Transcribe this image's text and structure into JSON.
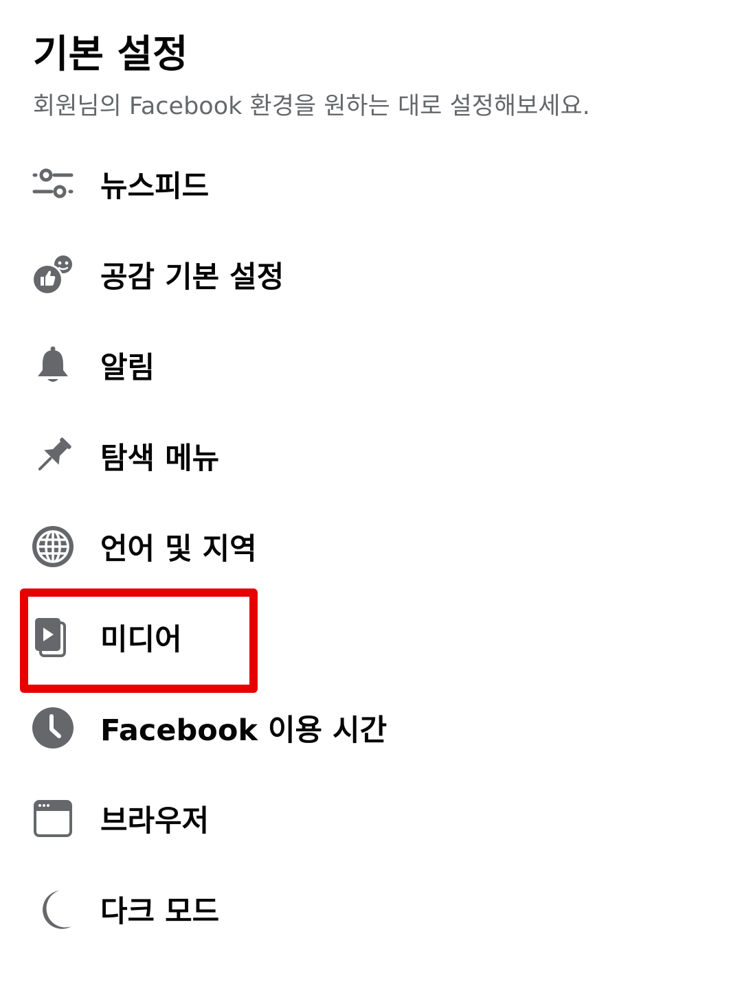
{
  "header": {
    "title": "기본 설정",
    "subtitle": "회원님의 Facebook 환경을 원하는 대로 설정해보세요."
  },
  "menu": {
    "items": [
      {
        "label": "뉴스피드",
        "icon": "sliders-icon"
      },
      {
        "label": "공감 기본 설정",
        "icon": "reactions-icon"
      },
      {
        "label": "알림",
        "icon": "bell-icon"
      },
      {
        "label": "탐색 메뉴",
        "icon": "pin-icon"
      },
      {
        "label": "언어 및 지역",
        "icon": "globe-icon"
      },
      {
        "label": "미디어",
        "icon": "media-icon"
      },
      {
        "label": "Facebook 이용 시간",
        "icon": "clock-icon"
      },
      {
        "label": "브라우저",
        "icon": "browser-icon"
      },
      {
        "label": "다크 모드",
        "icon": "moon-icon"
      }
    ]
  },
  "highlight": {
    "target": "미디어",
    "color": "#e60000"
  },
  "colors": {
    "icon": "#65676b",
    "title": "#050505",
    "subtitle": "#65676b"
  }
}
